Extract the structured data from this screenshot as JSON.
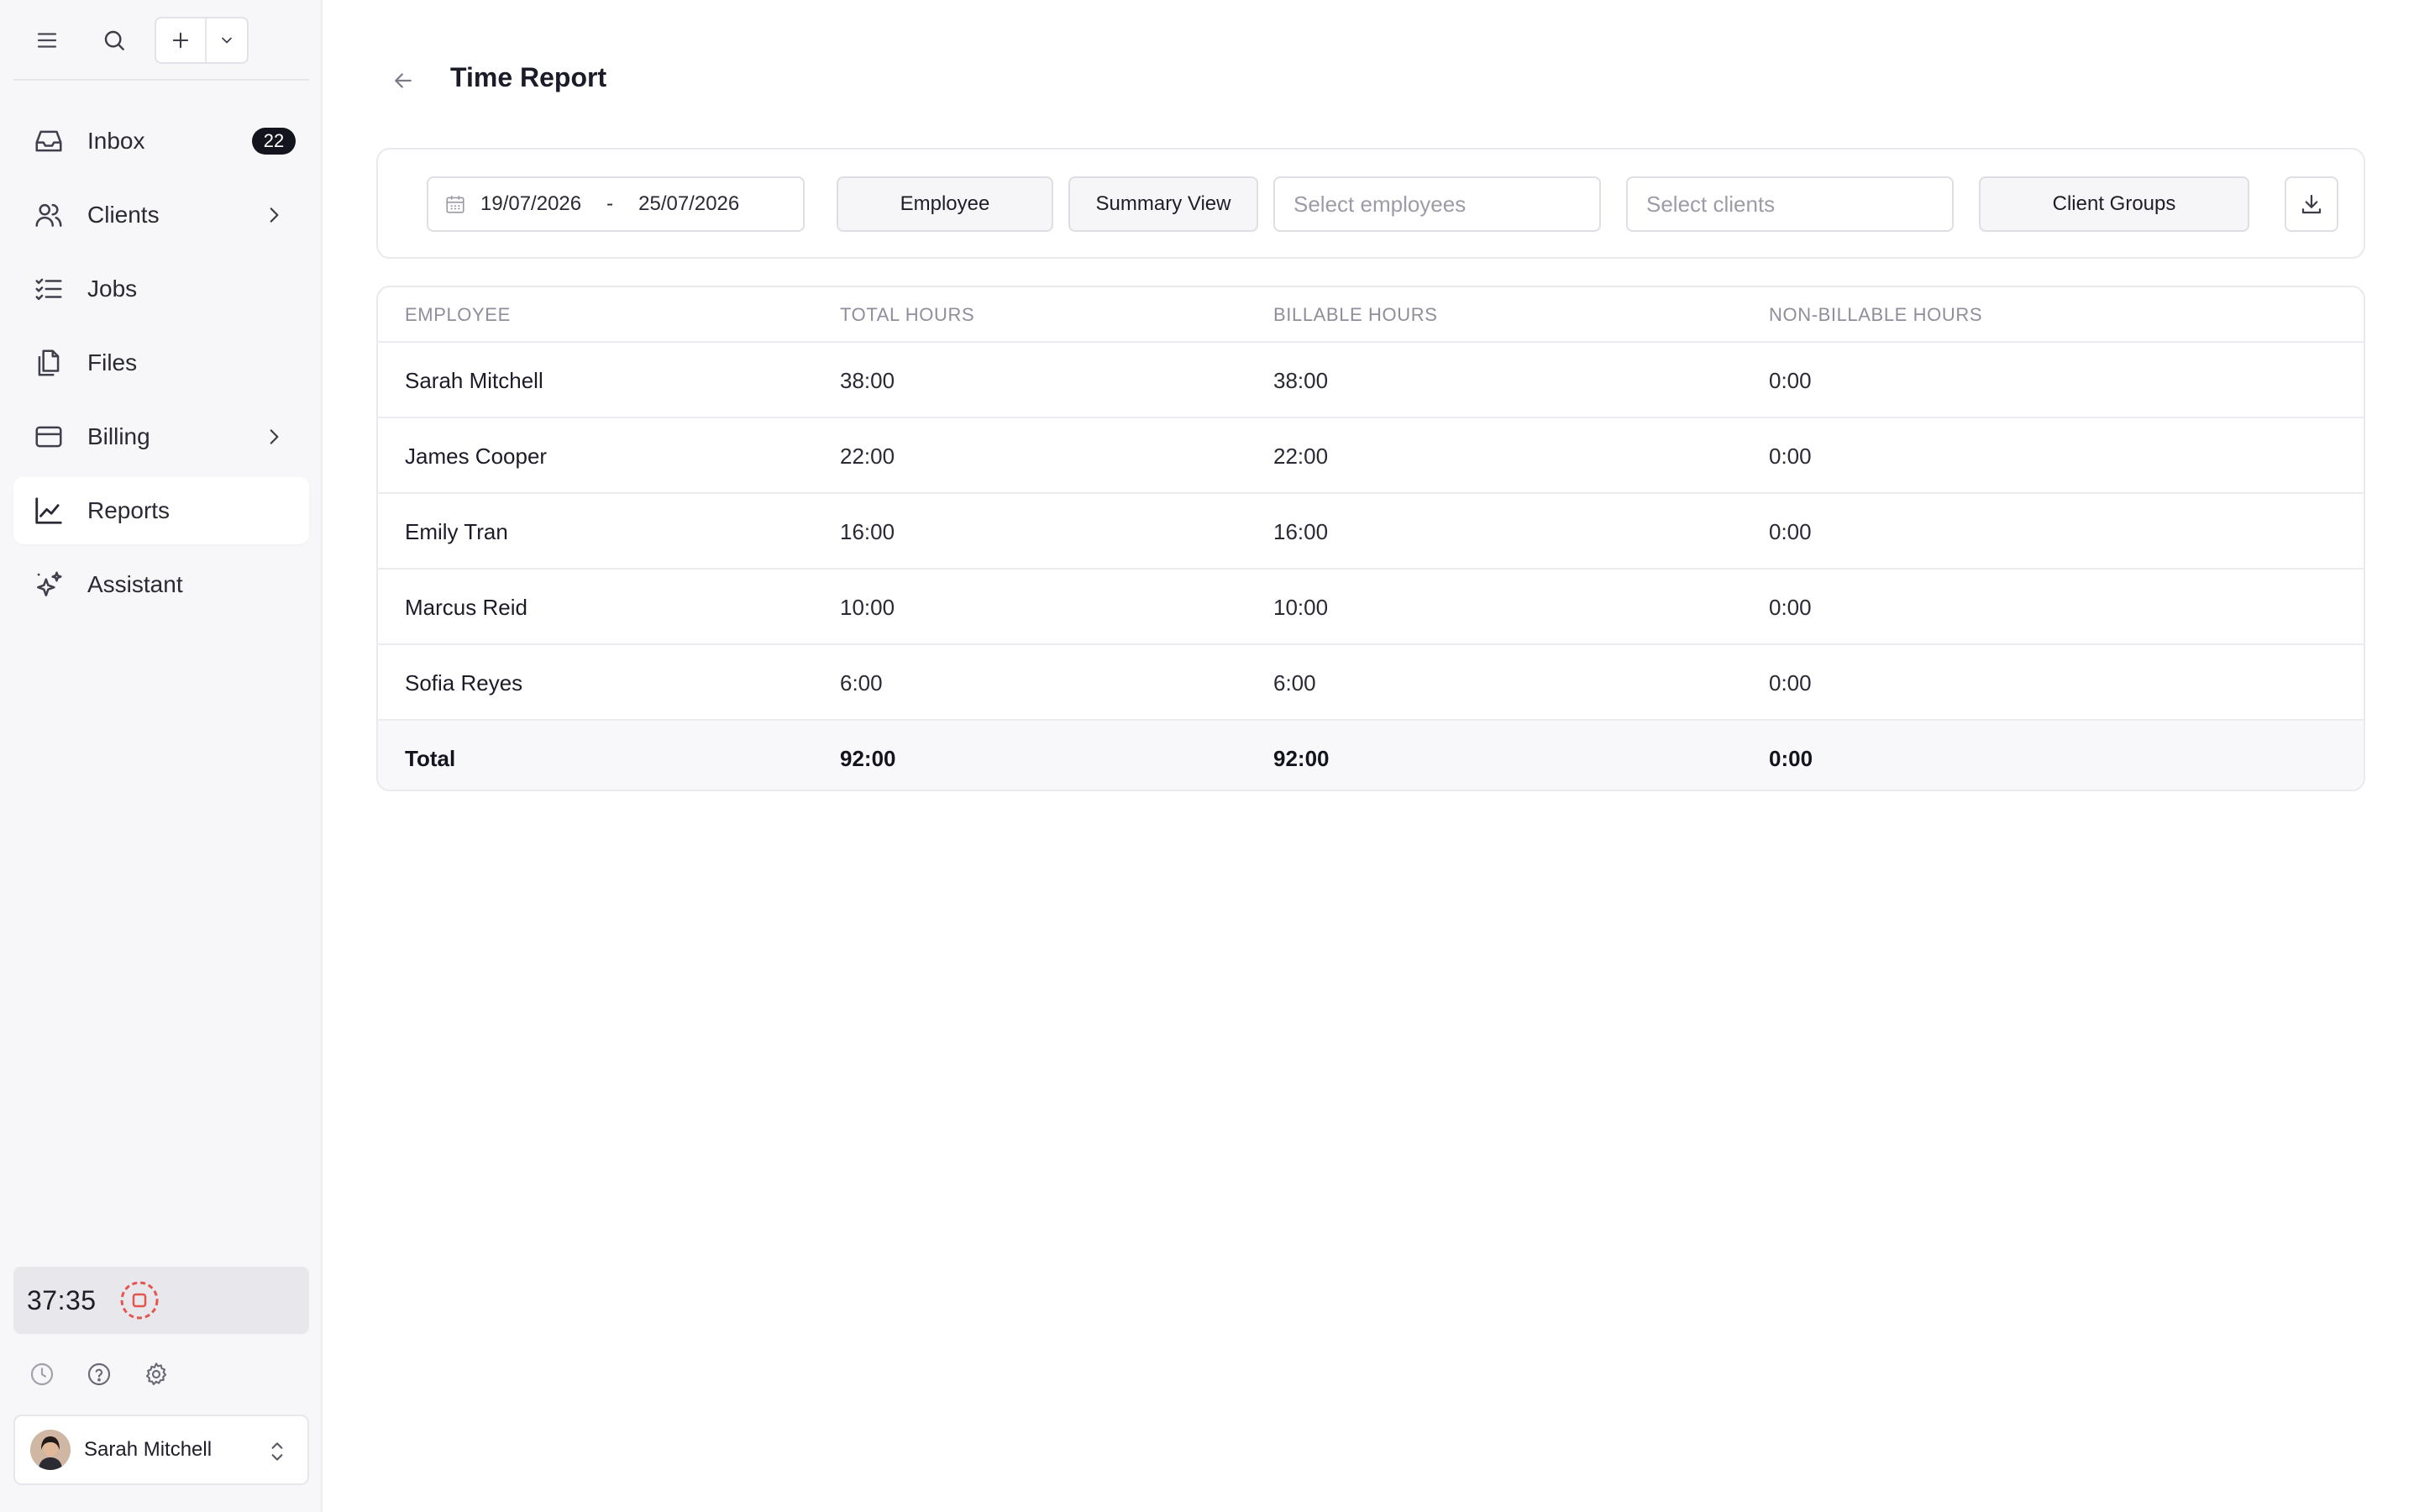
{
  "sidebar": {
    "nav": [
      {
        "label": "Inbox",
        "icon": "inbox-icon",
        "badge": "22"
      },
      {
        "label": "Clients",
        "icon": "users-icon",
        "has_submenu": true
      },
      {
        "label": "Jobs",
        "icon": "checklist-icon"
      },
      {
        "label": "Files",
        "icon": "files-icon"
      },
      {
        "label": "Billing",
        "icon": "credit-card-icon",
        "has_submenu": true
      },
      {
        "label": "Reports",
        "icon": "chart-line-icon",
        "active": true
      },
      {
        "label": "Assistant",
        "icon": "sparkles-icon"
      }
    ],
    "timer": {
      "value": "37:35",
      "stop_color": "#e5554f"
    },
    "user": {
      "name": "Sarah Mitchell"
    }
  },
  "page": {
    "title": "Time Report"
  },
  "filters": {
    "date_start": "19/07/2026",
    "date_separator": "-",
    "date_end": "25/07/2026",
    "group_by_label": "Employee",
    "view_label": "Summary View",
    "employees_placeholder": "Select employees",
    "clients_placeholder": "Select clients",
    "client_groups_label": "Client Groups"
  },
  "table": {
    "headers": [
      "EMPLOYEE",
      "TOTAL HOURS",
      "BILLABLE HOURS",
      "NON-BILLABLE HOURS"
    ],
    "rows": [
      {
        "employee": "Sarah Mitchell",
        "total": "38:00",
        "billable": "38:00",
        "non_billable": "0:00"
      },
      {
        "employee": "James Cooper",
        "total": "22:00",
        "billable": "22:00",
        "non_billable": "0:00"
      },
      {
        "employee": "Emily Tran",
        "total": "16:00",
        "billable": "16:00",
        "non_billable": "0:00"
      },
      {
        "employee": "Marcus Reid",
        "total": "10:00",
        "billable": "10:00",
        "non_billable": "0:00"
      },
      {
        "employee": "Sofia Reyes",
        "total": "6:00",
        "billable": "6:00",
        "non_billable": "0:00"
      }
    ],
    "total": {
      "employee": "Total",
      "total": "92:00",
      "billable": "92:00",
      "non_billable": "0:00"
    }
  },
  "colors": {
    "accent_dark": "#14141e",
    "sidebar_bg": "#f7f7f9",
    "timer_stop": "#e5554f"
  }
}
